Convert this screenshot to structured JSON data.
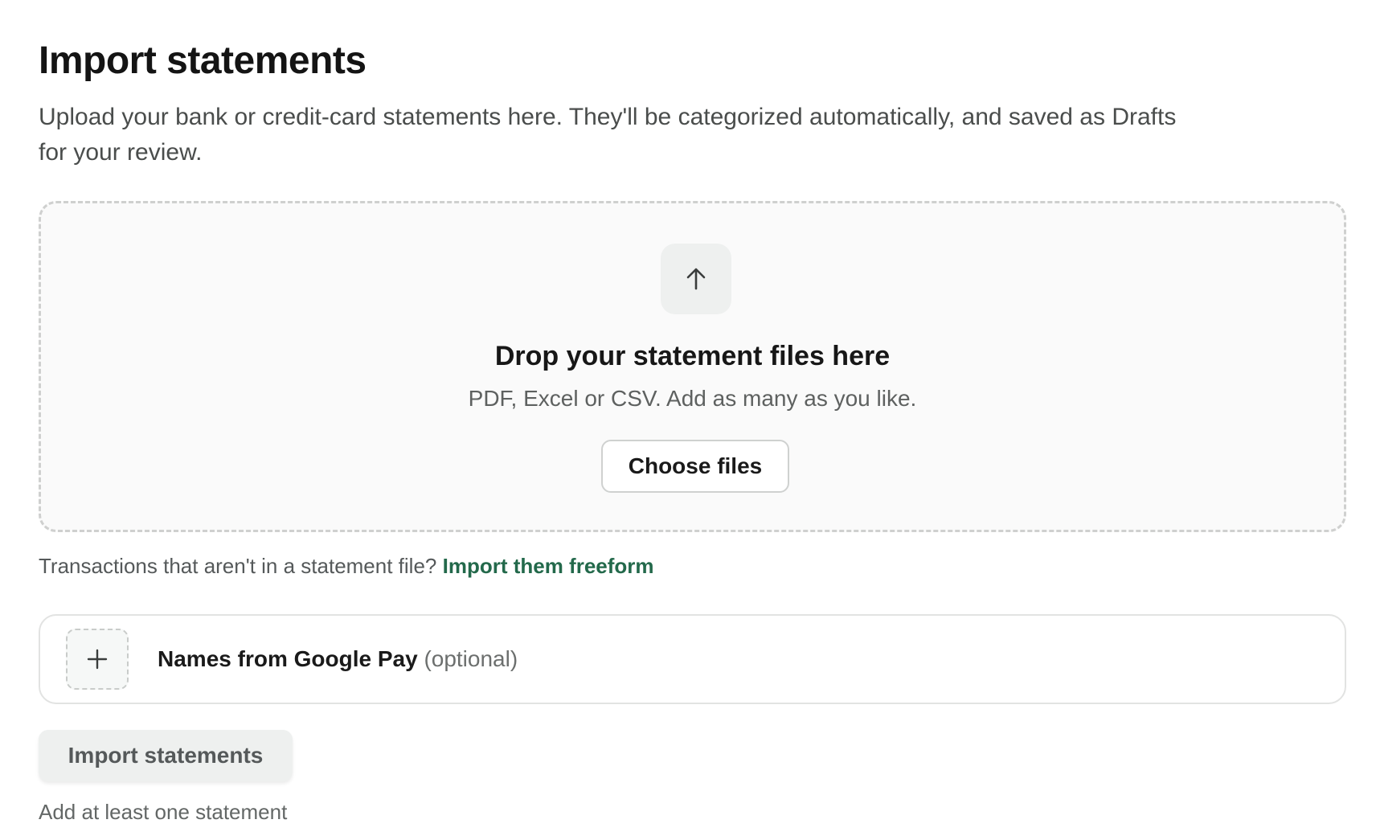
{
  "header": {
    "title": "Import statements",
    "description": "Upload your bank or credit-card statements here. They'll be categorized automatically, and saved as Drafts for your review."
  },
  "dropzone": {
    "icon": "arrow-up-icon",
    "title": "Drop your statement files here",
    "subtitle": "PDF, Excel or CSV. Add as many as you like.",
    "choose_button": "Choose files"
  },
  "freeform": {
    "prompt": "Transactions that aren't in a statement file?",
    "link": "Import them freeform"
  },
  "google_pay": {
    "icon": "plus-icon",
    "name": "Names from Google Pay",
    "optional": "(optional)"
  },
  "actions": {
    "submit_label": "Import statements",
    "hint": "Add at least one statement"
  },
  "colors": {
    "accent_link": "#23694b",
    "dropzone_bg": "#fafafa",
    "disabled_button_bg": "#eef0ef"
  }
}
